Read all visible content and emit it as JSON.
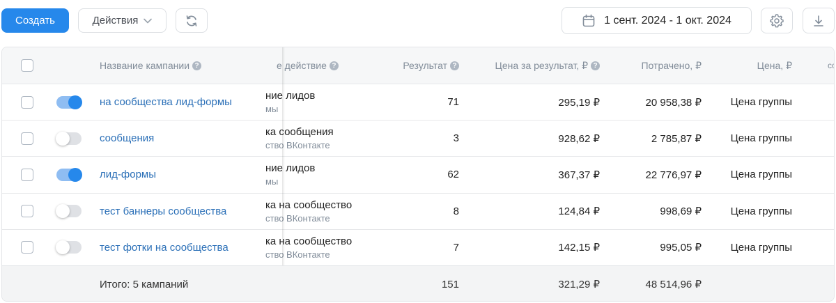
{
  "toolbar": {
    "create_label": "Создать",
    "actions_label": "Действия",
    "date_range": "1 сент. 2024 - 1 окт. 2024"
  },
  "table": {
    "headers": {
      "campaign_name": "Название кампании",
      "target_action": "е действие",
      "result": "Результат",
      "cost_per_result": "Цена за результат, ₽",
      "spent": "Потрачено, ₽",
      "price": "Цена, ₽",
      "cut_off": "сс"
    },
    "rows": [
      {
        "enabled": true,
        "name": "на сообщества лид-формы",
        "action_main": "ние лидов",
        "action_sub": "мы",
        "result": "71",
        "cost_per_result": "295,19 ₽",
        "spent": "20 958,38 ₽",
        "price": "Цена группы"
      },
      {
        "enabled": false,
        "name": "сообщения",
        "action_main": "ка сообщения",
        "action_sub": "ство ВКонтакте",
        "result": "3",
        "cost_per_result": "928,62 ₽",
        "spent": "2 785,87 ₽",
        "price": "Цена группы"
      },
      {
        "enabled": true,
        "name": "лид-формы",
        "action_main": "ние лидов",
        "action_sub": "мы",
        "result": "62",
        "cost_per_result": "367,37 ₽",
        "spent": "22 776,97 ₽",
        "price": "Цена группы"
      },
      {
        "enabled": false,
        "name": "тест баннеры сообщества",
        "action_main": "ка на сообщество",
        "action_sub": "ство ВКонтакте",
        "result": "8",
        "cost_per_result": "124,84 ₽",
        "spent": "998,69 ₽",
        "price": "Цена группы"
      },
      {
        "enabled": false,
        "name": "тест фотки на сообщества",
        "action_main": "ка на сообщество",
        "action_sub": "ство ВКонтакте",
        "result": "7",
        "cost_per_result": "142,15 ₽",
        "spent": "995,05 ₽",
        "price": "Цена группы"
      }
    ],
    "footer": {
      "total_label": "Итого: 5 кампаний",
      "result": "151",
      "cost_per_result": "321,29 ₽",
      "spent": "48 514,96 ₽"
    }
  },
  "icons": {
    "chevron": "chevron-down-icon",
    "refresh": "refresh-icon",
    "calendar": "calendar-icon",
    "settings": "gear-icon",
    "download": "download-icon",
    "help": "help-icon"
  },
  "colors": {
    "primary": "#2688eb",
    "link": "#2a6fb7",
    "muted": "#818c99",
    "toggle_on_track": "#8fbdf2"
  }
}
